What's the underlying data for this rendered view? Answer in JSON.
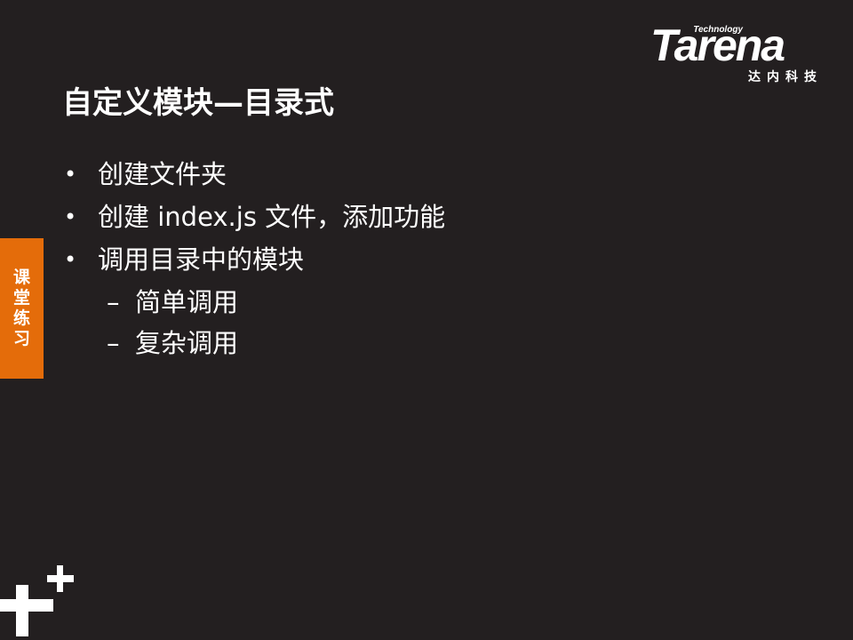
{
  "logo": {
    "tagline": "Technology",
    "word": "Tarena",
    "chinese": "达内科技"
  },
  "slide": {
    "title": "自定义模块—目录式",
    "bullets": [
      {
        "text": "创建文件夹"
      },
      {
        "text": "创建 index.js 文件，添加功能"
      },
      {
        "text": "调用目录中的模块"
      }
    ],
    "sub_items": [
      {
        "text": "简单调用"
      },
      {
        "text": "复杂调用"
      }
    ],
    "bullet_glyph": "•",
    "sub_glyph": "–"
  },
  "side_tab": {
    "label": "课堂练习",
    "color": "#e46c0a"
  },
  "colors": {
    "background": "#231f20",
    "text": "#ffffff"
  },
  "icons": {
    "decoration": "plus-icon"
  }
}
